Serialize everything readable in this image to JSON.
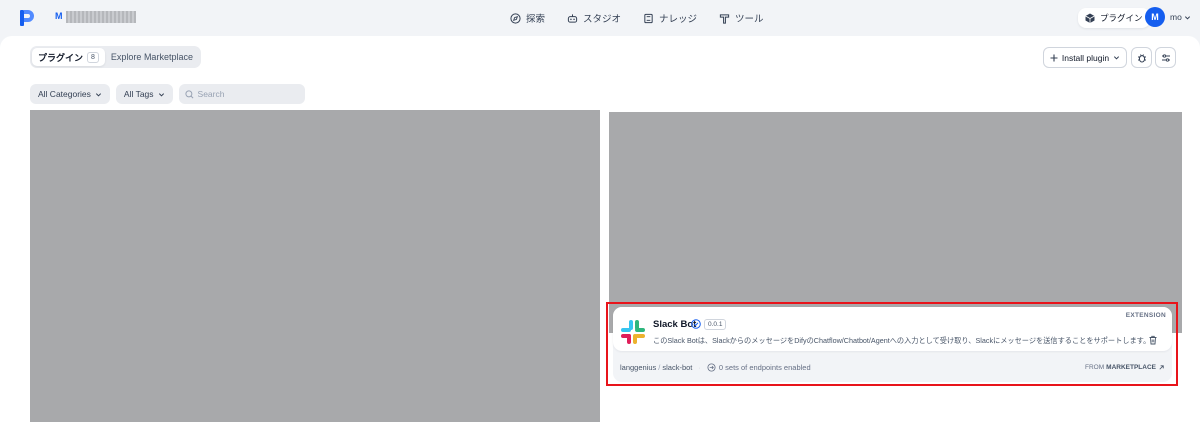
{
  "header": {
    "workspace_initial": "M",
    "nav": [
      {
        "label": "探索",
        "icon": "compass-icon"
      },
      {
        "label": "スタジオ",
        "icon": "robot-icon"
      },
      {
        "label": "ナレッジ",
        "icon": "book-icon"
      },
      {
        "label": "ツール",
        "icon": "hammer-icon"
      }
    ],
    "plugins_label": "プラグイン",
    "user_initial": "M",
    "user_name": "mo"
  },
  "tabs": [
    {
      "label": "プラグイン",
      "count": "8",
      "active": true
    },
    {
      "label": "Explore Marketplace",
      "active": false
    }
  ],
  "toolbar": {
    "install_label": "Install plugin"
  },
  "filters": {
    "categories_label": "All Categories",
    "tags_label": "All Tags",
    "search_placeholder": "Search"
  },
  "plugin_card": {
    "name": "Slack Bot",
    "version": "0.0.1",
    "category": "EXTENSION",
    "description": "このSlack Botは、SlackからのメッセージをDifyのChatflow/Chatbot/Agentへの入力として受け取り、Slackにメッセージを送信することをサポートします。",
    "author": "langgenius",
    "slug": "slack-bot",
    "endpoints": "0 sets of endpoints enabled",
    "source_prefix": "FROM",
    "source": "MARKETPLACE"
  },
  "colors": {
    "accent": "#155eef",
    "highlight": "#e8141b",
    "placeholder_block": "#a8a9ab"
  }
}
